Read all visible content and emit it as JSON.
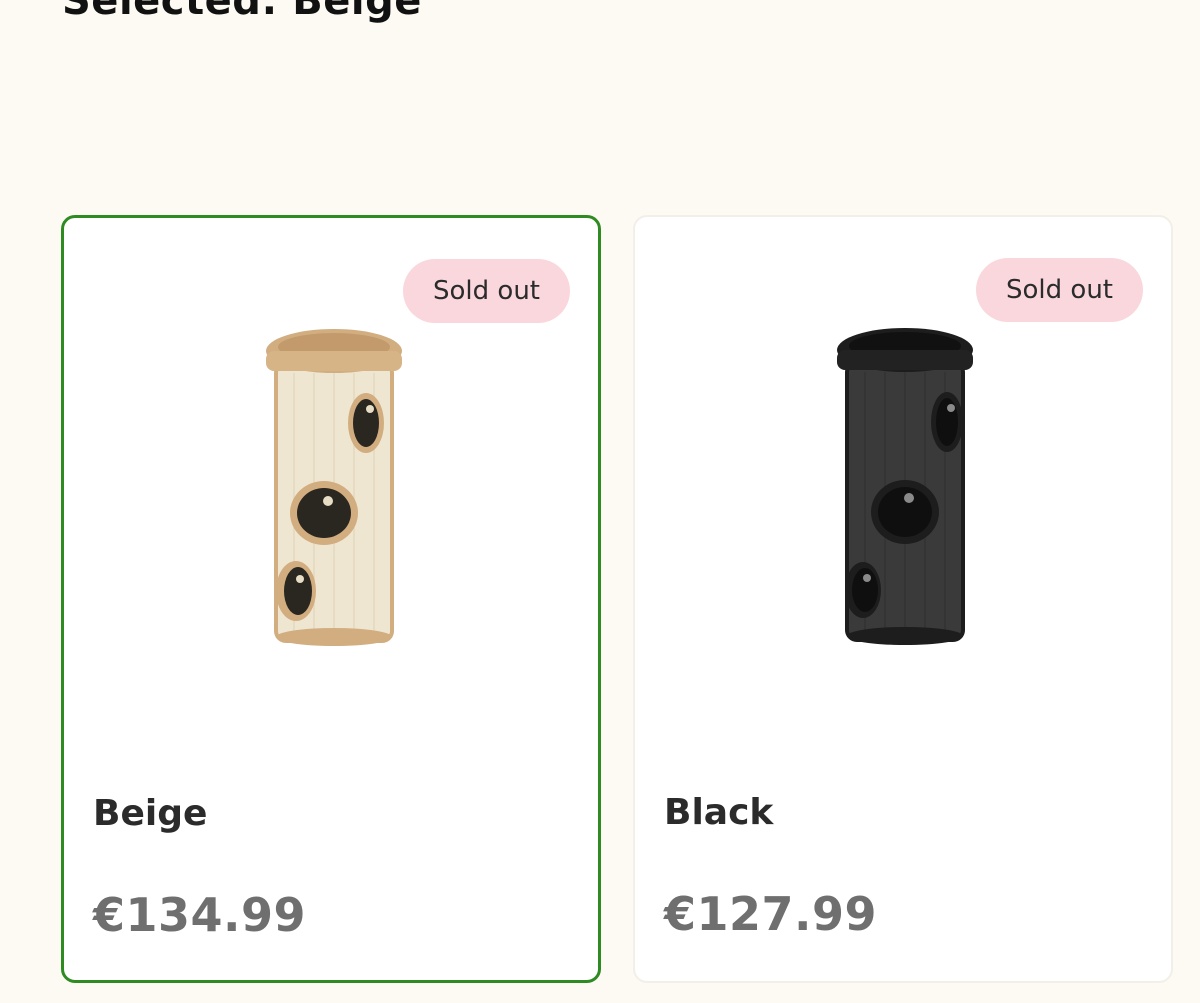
{
  "selection": {
    "label": "Selected: Beige"
  },
  "variants": [
    {
      "name": "Beige",
      "price": "€134.99",
      "badge": "Sold out",
      "selected": true,
      "image": "beige-cat-tower-barrel",
      "colors": {
        "body": "#efe6d2",
        "trim": "#d2ad80",
        "hole": "#2a2620"
      }
    },
    {
      "name": "Black",
      "price": "€127.99",
      "badge": "Sold out",
      "selected": false,
      "image": "black-cat-tower-barrel",
      "colors": {
        "body": "#3a3a3a",
        "trim": "#1d1d1d",
        "hole": "#0f0f0f"
      }
    }
  ],
  "colors": {
    "page_background": "#fdfaf3",
    "card_background": "#ffffff",
    "selected_border": "#2e8b22",
    "badge_background": "#f9d7dd",
    "price_text": "#6f6f6f"
  }
}
